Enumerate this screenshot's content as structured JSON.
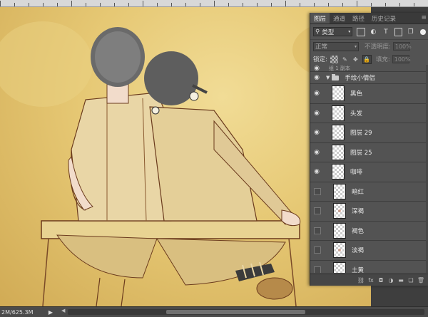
{
  "ruler": {
    "ticks": [
      "",
      "",
      "",
      "",
      "",
      "",
      "",
      ""
    ]
  },
  "status": {
    "doc_size": "2M/625.3M",
    "arrow": "▶"
  },
  "colors": {
    "panel_bg": "#535353",
    "canvas_bg": "#e6c874"
  },
  "layers_panel": {
    "tabs": [
      {
        "label": "图层",
        "active": true
      },
      {
        "label": "通道",
        "active": false
      },
      {
        "label": "路径",
        "active": false
      },
      {
        "label": "历史记录",
        "active": false
      }
    ],
    "filter": {
      "label": "类型",
      "icons": [
        "image-filter-icon",
        "adjustment-filter-icon",
        "type-filter-icon",
        "shape-filter-icon",
        "smart-object-filter-icon"
      ]
    },
    "blend_mode": "正常",
    "opacity_label": "不透明度:",
    "opacity_value": "100%",
    "lock_label": "锁定:",
    "fill_label": "填充:",
    "fill_value": "100%",
    "partial_layer_name": "组 1 副本",
    "group": {
      "name": "手绘小情侣"
    },
    "layers": [
      {
        "name": "黑色",
        "visible": true
      },
      {
        "name": "头发",
        "visible": true
      },
      {
        "name": "图层 29",
        "visible": true
      },
      {
        "name": "图层 25",
        "visible": true
      },
      {
        "name": "咖啡",
        "visible": true
      },
      {
        "name": "暗红",
        "visible": false
      },
      {
        "name": "深褐",
        "visible": false
      },
      {
        "name": "褐色",
        "visible": false
      },
      {
        "name": "淡褐",
        "visible": false
      },
      {
        "name": "土黄",
        "visible": false
      }
    ],
    "bottom_icons": [
      "link-icon",
      "fx-icon",
      "mask-icon",
      "adjustment-icon",
      "group-icon",
      "new-layer-icon",
      "trash-icon"
    ]
  }
}
